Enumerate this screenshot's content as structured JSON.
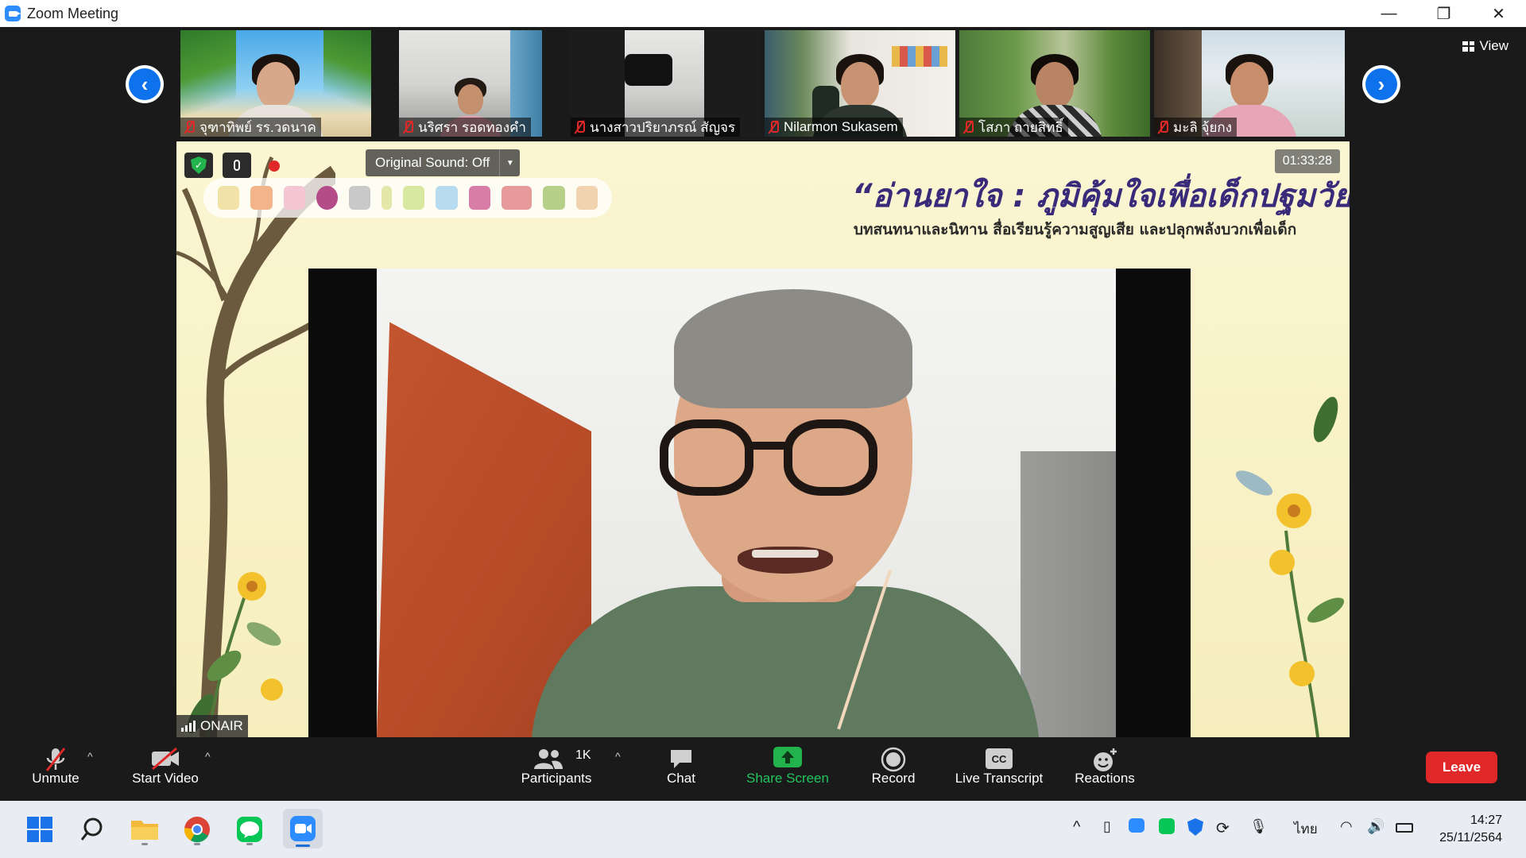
{
  "window": {
    "title": "Zoom Meeting",
    "minimize_glyph": "—",
    "restore_glyph": "❐",
    "close_glyph": "✕"
  },
  "thumbnails": [
    {
      "name": "จุฑาทิพย์ รร.วดนาค"
    },
    {
      "name": "นริศรา รอดทองคำ"
    },
    {
      "name": "นางสาวปริยาภรณ์  สัญจร"
    },
    {
      "name": "Nilarmon Sukasem"
    },
    {
      "name": "โสภา ถายสิทธิ์"
    },
    {
      "name": "มะลิ จุ้ยกง"
    }
  ],
  "view_button": {
    "label": "View"
  },
  "main_video": {
    "timer": "01:33:28",
    "original_sound": "Original Sound: Off",
    "slide_title": "“อ่านยาใจ : ภูมิคุ้มใจเพื่อเด็กปฐมวัย”",
    "slide_subtitle": "บทสนทนาและนิทาน สื่อเรียนรู้ความสูญเสีย และปลุกพลังบวกเพื่อเด็ก",
    "speaker_label": "ONAIR"
  },
  "toolbar": {
    "unmute": "Unmute",
    "start_video": "Start Video",
    "participants": "Participants",
    "participants_count": "1K",
    "chat": "Chat",
    "share_screen": "Share Screen",
    "record": "Record",
    "live_transcript": "Live Transcript",
    "reactions": "Reactions",
    "leave": "Leave",
    "cc_glyph": "CC"
  },
  "taskbar": {
    "language": "ไทย",
    "time": "14:27",
    "date": "25/11/2564"
  },
  "colors": {
    "accent": "#0e72ed",
    "share_green": "#22b34c",
    "leave_red": "#e02828",
    "muted_red": "#e02828"
  }
}
